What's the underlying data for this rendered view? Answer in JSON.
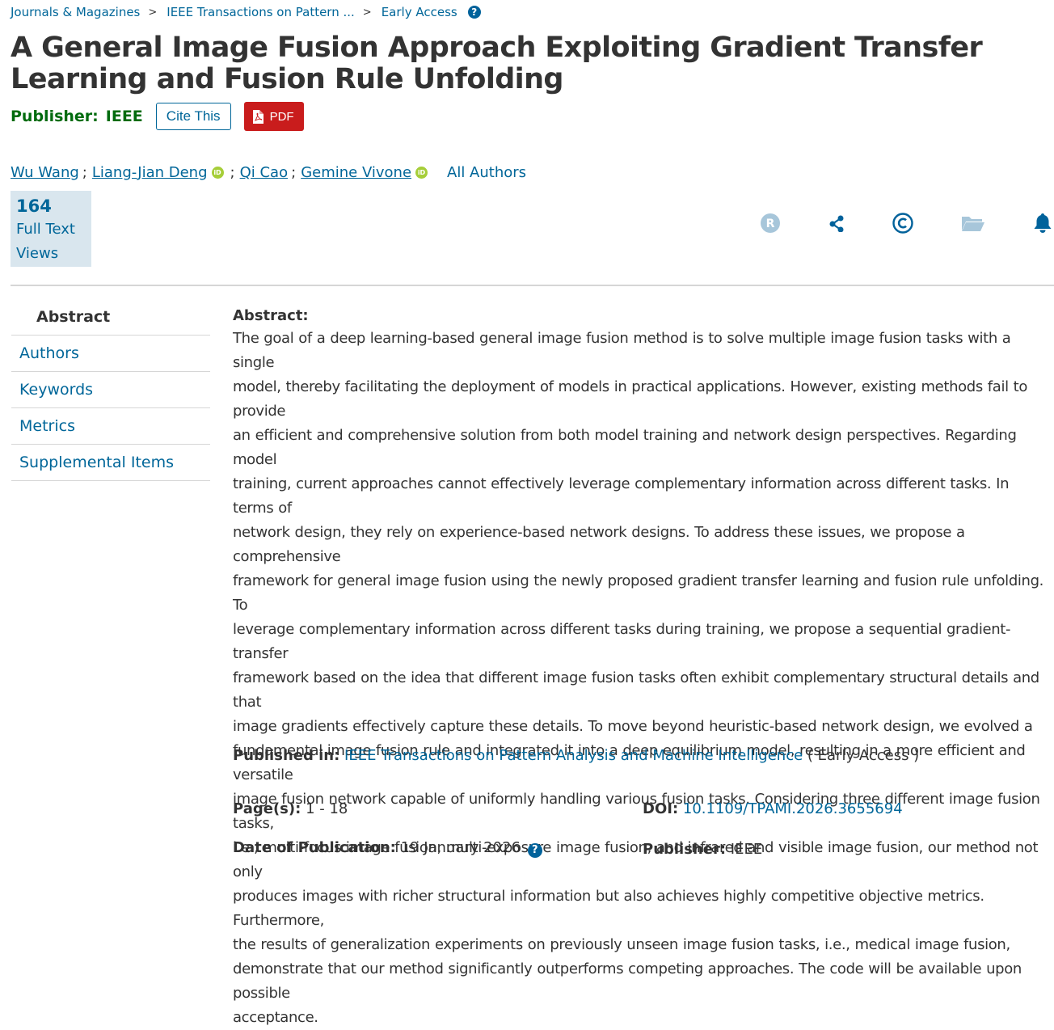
{
  "breadcrumb": {
    "items": [
      "Journals & Magazines",
      "IEEE Transactions on Pattern ...",
      "Early Access"
    ],
    "separator": ">"
  },
  "article": {
    "title": "A General Image Fusion Approach Exploiting Gradient Transfer Learning and Fusion Rule Unfolding",
    "publisher_label": "Publisher:",
    "publisher": "IEEE",
    "cite_label": "Cite This",
    "pdf_label": "PDF"
  },
  "authors": [
    {
      "name": "Wu Wang",
      "orcid": false
    },
    {
      "name": "Liang-Jian Deng",
      "orcid": true
    },
    {
      "name": "Qi Cao",
      "orcid": false
    },
    {
      "name": "Gemine Vivone",
      "orcid": true
    }
  ],
  "author_separator": ";",
  "all_authors_label": "All Authors",
  "metrics": {
    "count": "164",
    "label": "Full Text Views"
  },
  "actions": [
    "rights-icon",
    "share-icon",
    "copyright-icon",
    "folder-icon",
    "bell-icon"
  ],
  "nav": [
    {
      "label": "Abstract",
      "active": true
    },
    {
      "label": "Authors",
      "active": false
    },
    {
      "label": "Keywords",
      "active": false
    },
    {
      "label": "Metrics",
      "active": false
    },
    {
      "label": "Supplemental Items",
      "active": false
    }
  ],
  "abstract": {
    "heading": "Abstract:",
    "lines": [
      "The goal of a deep learning-based general image fusion method is to solve multiple image fusion tasks with a single",
      "model, thereby facilitating the deployment of models in practical applications. However, existing methods fail to provide",
      "an efficient and comprehensive solution from both model training and network design perspectives. Regarding model",
      "training, current approaches cannot effectively leverage complementary information across different tasks. In terms of",
      "network design, they rely on experience-based network designs. To address these issues, we propose a comprehensive",
      "framework for general image fusion using the newly proposed gradient transfer learning and fusion rule unfolding. To",
      "leverage complementary information across different tasks during training, we propose a sequential gradient-transfer",
      "framework based on the idea that different image fusion tasks often exhibit complementary structural details and that",
      "image gradients effectively capture these details. To move beyond heuristic-based network design, we evolved a",
      "fundamental image fusion rule and integrated it into a deep equilibrium model, resulting in a more efficient and versatile",
      "image fusion network capable of uniformly handling various fusion tasks. Considering three different image fusion tasks,",
      "i.e., multi-focus image fusion, multi-exposure image fusion, and infrared and visible image fusion, our method not only",
      "produces images with richer structural information but also achieves highly competitive objective metrics. Furthermore,",
      "the results of generalization experiments on previously unseen image fusion tasks, i.e., medical image fusion,",
      "demonstrate that our method significantly outperforms competing approaches. The code will be available upon possible",
      "acceptance."
    ]
  },
  "details": {
    "published_in_label": "Published in:",
    "published_in": "IEEE Transactions on Pattern Analysis and Machine Intelligence",
    "status_open": "( Early Access )",
    "pages_label": "Page(s):",
    "pages": "1 - 18",
    "doi_label": "DOI:",
    "doi": "10.1109/TPAMI.2026.3655694",
    "date_label": "Date of Publication:",
    "date": "19 January 2026",
    "publisher_label": "Publisher:",
    "publisher": "IEEE"
  },
  "colors": {
    "link": "#006699",
    "publisher_green": "#006b0e",
    "pdf_red": "#c91c1c",
    "metrics_bg": "#d9e6ee",
    "orcid_green": "#a6ce39",
    "icon_blue": "#00629b"
  }
}
